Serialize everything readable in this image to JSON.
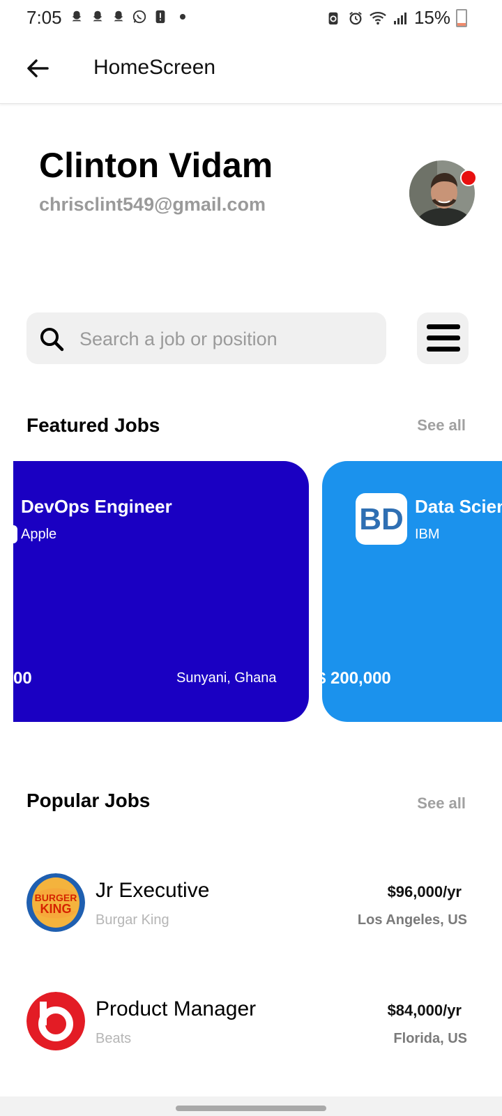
{
  "status_bar": {
    "time": "7:05",
    "battery": "15%"
  },
  "app_bar": {
    "title": "HomeScreen"
  },
  "profile": {
    "name": "Clinton Vidam",
    "email": "chrisclint549@gmail.com"
  },
  "search": {
    "placeholder": "Search a job or position"
  },
  "featured": {
    "title": "Featured Jobs",
    "see_all": "See all",
    "cards": [
      {
        "title": "DevOps Engineer",
        "company": "Apple",
        "salary": "00",
        "location": "Sunyani, Ghana",
        "color": "#1a00c2"
      },
      {
        "title": "Data Scien",
        "company": "IBM",
        "salary": "$ 200,000",
        "logo_text": "BD",
        "color": "#1b92ed"
      }
    ]
  },
  "popular": {
    "title": "Popular Jobs",
    "see_all": "See all",
    "jobs": [
      {
        "title": "Jr Executive",
        "company": "Burgar King",
        "salary": "$96,000/yr",
        "location": "Los Angeles, US",
        "logo": "BURGER KING"
      },
      {
        "title": "Product Manager",
        "company": "Beats",
        "salary": "$84,000/yr",
        "location": "Florida, US",
        "logo": "b"
      }
    ]
  },
  "colors": {
    "featured_card_1": "#1a00c2",
    "featured_card_2": "#1b92ed",
    "notification_dot": "#e81010"
  }
}
